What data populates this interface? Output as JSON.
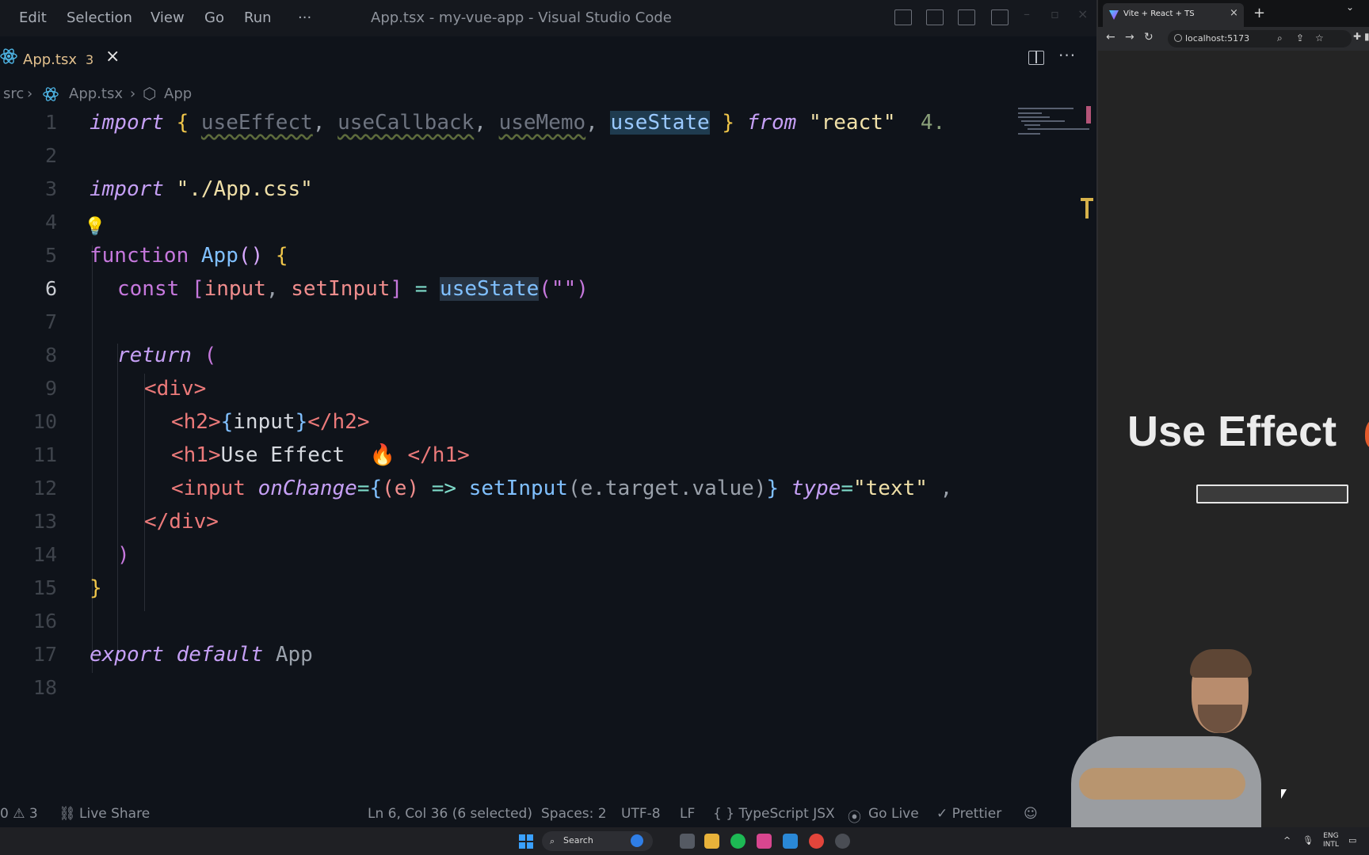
{
  "vscode": {
    "menu": [
      "Edit",
      "Selection",
      "View",
      "Go",
      "Run",
      "···"
    ],
    "window_title": "App.tsx - my-vue-app - Visual Studio Code",
    "tab": {
      "name": "App.tsx",
      "problems": "3",
      "close": "×"
    },
    "more_actions": "···",
    "breadcrumbs": [
      "src",
      "›",
      "App.tsx",
      "›",
      "App"
    ],
    "line_numbers": [
      "1",
      "2",
      "3",
      "4",
      "5",
      "6",
      "7",
      "8",
      "9",
      "10",
      "11",
      "12",
      "13",
      "14",
      "15",
      "16",
      "17",
      "18"
    ],
    "code": {
      "l1": {
        "kw": "import",
        "ob": "{",
        "a": "useEffect",
        "c1": ",",
        "b": "useCallback",
        "c2": ",",
        "c": "useMemo",
        "c3": ",",
        "d": "useState",
        "cb": "}",
        "from": "from",
        "mod": "\"react\"",
        "size": "4."
      },
      "l3": {
        "kw": "import",
        "mod": "\"./App.css\""
      },
      "l5": {
        "kw": "function",
        "name": "App",
        "paren": "()",
        "ob": "{"
      },
      "l6": {
        "kw": "const",
        "lb": "[",
        "a": "input",
        "comma": ",",
        "b": "setInput",
        "rb": "]",
        "eq": "=",
        "fn": "useState",
        "args": "(\"\")"
      },
      "l8": {
        "kw": "return",
        "paren": "("
      },
      "l9": {
        "tag": "<div>"
      },
      "l10": {
        "open": "<h2>",
        "ob": "{",
        "var": "input",
        "cb": "}",
        "close": "</h2>"
      },
      "l11": {
        "open": "<h1>",
        "text": "Use Effect ",
        "emoji": "🔥",
        "close": " </h1>"
      },
      "l12": {
        "open": "<input",
        "attr": "onChange",
        "eq": "=",
        "ob": "{",
        "p": "(e)",
        "arrow": "=>",
        "fn": "setInput",
        "arg": "(e.target.value)",
        "cb": "}",
        "attr2": "type",
        "eq2": "=",
        "val": "\"text\"",
        "trail": " ,"
      },
      "l13": {
        "tag": "</div>"
      },
      "l14": {
        "paren": ")"
      },
      "l15": {
        "cb": "}"
      },
      "l17": {
        "a": "export",
        "b": "default",
        "c": "App"
      }
    },
    "status": {
      "problems": "0 ⚠ 3",
      "live_share": "Live Share",
      "position": "Ln 6, Col 36 (6 selected)",
      "spaces": "Spaces: 2",
      "encoding": "UTF-8",
      "eol": "LF",
      "language": "{ }  TypeScript JSX",
      "go_live": "Go Live",
      "prettier": "✓ Prettier"
    }
  },
  "browser": {
    "tab_title": "Vite + React + TS",
    "tab_close": "×",
    "new_tab": "+",
    "url": "localhost:5173",
    "heading": "Use Effect"
  },
  "taskbar": {
    "search_label": "Search",
    "lang_top": "ENG",
    "lang_bottom": "INTL"
  },
  "colors": {
    "editor_bg": "#0f131a",
    "keyword": "#c678dd",
    "string": "#f0e0a8",
    "brace": "#f0c64a",
    "tag": "#ec7a7a",
    "selection": "#1f3b4f"
  }
}
